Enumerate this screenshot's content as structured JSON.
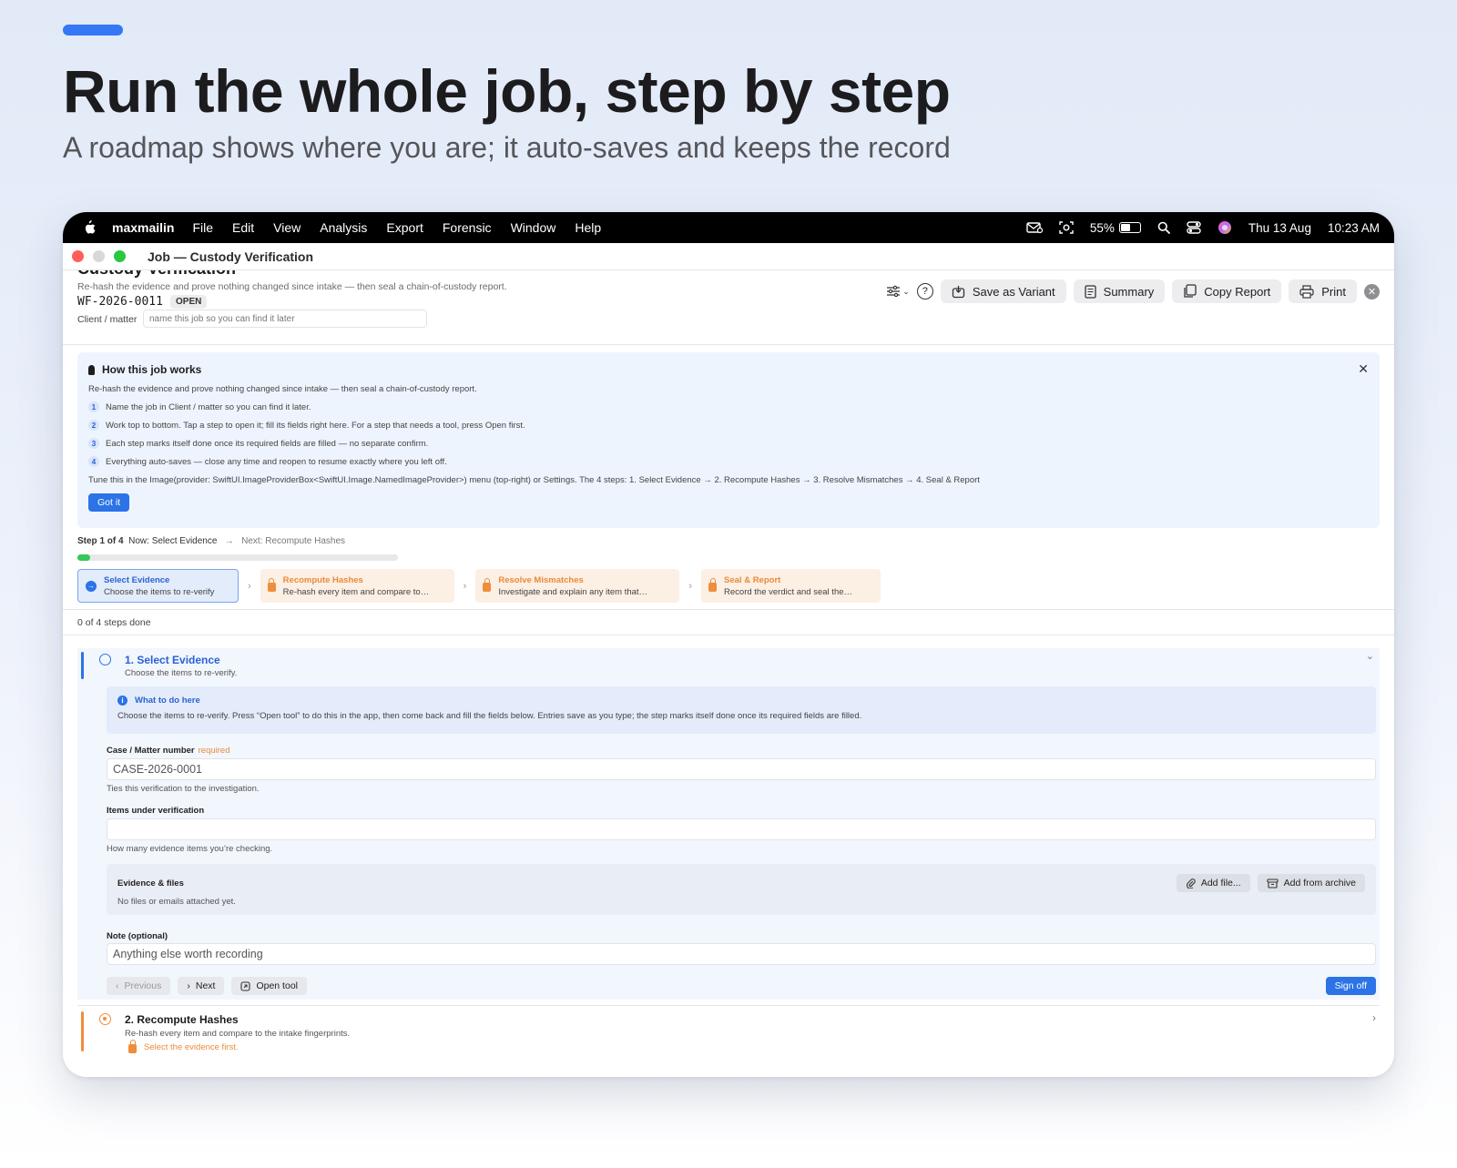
{
  "hero": {
    "headline": "Run the whole job, step by step",
    "subhead": "A roadmap shows where you are; it auto-saves and keeps the record"
  },
  "menubar": {
    "app_name": "maxmailin",
    "items": [
      "File",
      "Edit",
      "View",
      "Analysis",
      "Export",
      "Forensic",
      "Window",
      "Help"
    ],
    "battery_percent": "55%",
    "battery_level": 0.55,
    "date": "Thu 13 Aug",
    "time": "10:23 AM"
  },
  "window": {
    "title": "Job — Custody Verification"
  },
  "job": {
    "title_cut": "Custody Verification",
    "description": "Re-hash the evidence and prove nothing changed since intake — then seal a chain-of-custody report.",
    "id": "WF-2026-0011",
    "status": "OPEN",
    "client_label": "Client / matter",
    "client_placeholder": "name this job so you can find it later"
  },
  "toolbar": {
    "save_variant": "Save as Variant",
    "summary": "Summary",
    "copy_report": "Copy Report",
    "print": "Print"
  },
  "how": {
    "title": "How this job works",
    "description": "Re-hash the evidence and prove nothing changed since intake — then seal a chain-of-custody report.",
    "items": [
      {
        "num": "1",
        "text": "Name the job in Client / matter so you can find it later."
      },
      {
        "num": "2",
        "text": "Work top to bottom. Tap a step to open it; fill its fields right here. For a step that needs a tool, press Open first."
      },
      {
        "num": "3",
        "text": "Each step marks itself done once its required fields are filled — no separate confirm."
      },
      {
        "num": "4",
        "text": "Everything auto-saves — close any time and reopen to resume exactly where you left off."
      }
    ],
    "tune": "Tune this in the Image(provider: SwiftUI.ImageProviderBox<SwiftUI.Image.NamedImageProvider>) menu (top-right) or Settings. The 4 steps:  1. Select Evidence  →  2. Recompute Hashes  →  3. Resolve Mismatches  →  4. Seal & Report",
    "got_it": "Got it"
  },
  "progress": {
    "step_of": "Step 1 of 4",
    "now": "Now: Select Evidence",
    "next": "Next: Recompute Hashes",
    "fraction": 0.012,
    "done_text": "0 of 4 steps done"
  },
  "chips": [
    {
      "title": "Select Evidence",
      "sub": "Choose the items to re-verify",
      "state": "active"
    },
    {
      "title": "Recompute Hashes",
      "sub": "Re-hash every item and compare to…",
      "state": "locked"
    },
    {
      "title": "Resolve Mismatches",
      "sub": "Investigate and explain any item that…",
      "state": "locked"
    },
    {
      "title": "Seal & Report",
      "sub": "Record the verdict and seal the…",
      "state": "locked"
    }
  ],
  "step1": {
    "title": "1. Select Evidence",
    "subtitle": "Choose the items to re-verify.",
    "what_title": "What to do here",
    "what_desc": "Choose the items to re-verify. Press “Open tool” to do this in the app, then come back and fill the fields below. Entries save as you type; the step marks itself done once its required fields are filled.",
    "case_label": "Case / Matter number",
    "required": "required",
    "case_placeholder": "CASE-2026-0001",
    "case_help": "Ties this verification to the investigation.",
    "items_label": "Items under verification",
    "items_value": "",
    "items_help": "How many evidence items you’re checking.",
    "evidence_title": "Evidence & files",
    "evidence_desc": "No files or emails attached yet.",
    "add_file": "Add file...",
    "add_archive": "Add from archive",
    "note_label": "Note (optional)",
    "note_placeholder": "Anything else worth recording",
    "previous": "Previous",
    "next": "Next",
    "open_tool": "Open tool",
    "sign_off": "Sign off"
  },
  "step2": {
    "title": "2. Recompute Hashes",
    "subtitle": "Re-hash every item and compare to the intake fingerprints.",
    "warning": "Select the evidence first."
  }
}
